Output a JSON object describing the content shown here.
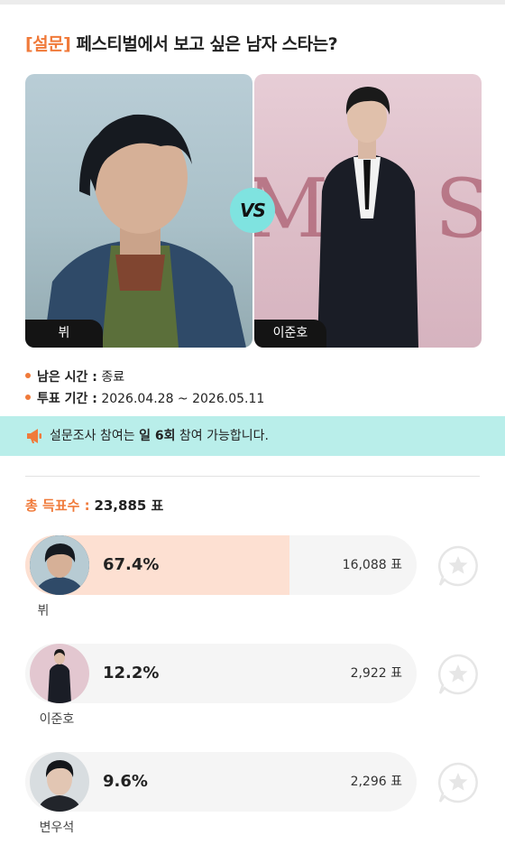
{
  "survey": {
    "tag": "[설문]",
    "question": "페스티벌에서 보고 싶은 남자 스타는?"
  },
  "versus": {
    "left_name": "뷔",
    "right_name": "이준호",
    "vs_label": "VS"
  },
  "info": {
    "remaining_label": "남은 시간 :",
    "remaining_value": "종료",
    "period_label": "투표 기간 :",
    "period_value": "2026.04.28 ~ 2026.05.11"
  },
  "notice": {
    "prefix": "설문조사 참여는",
    "emphasis": "일 6회",
    "suffix": "참여 가능합니다."
  },
  "total": {
    "label": "총 득표수 :",
    "value": "23,885 표"
  },
  "results": [
    {
      "name": "뷔",
      "percent_label": "67.4%",
      "percent": 67.4,
      "votes": "16,088 표",
      "highlight": "#fde0d2"
    },
    {
      "name": "이준호",
      "percent_label": "12.2%",
      "percent": 12.2,
      "votes": "2,922 표",
      "highlight": "#f5f5f5"
    },
    {
      "name": "변우석",
      "percent_label": "9.6%",
      "percent": 9.6,
      "votes": "2,296 표",
      "highlight": "#f5f5f5"
    }
  ],
  "colors": {
    "accent": "#f07a3a",
    "notice_bg": "#b9eeea",
    "vs_badge": "#7fe3e0",
    "leader_fill": "#fde0d2"
  }
}
